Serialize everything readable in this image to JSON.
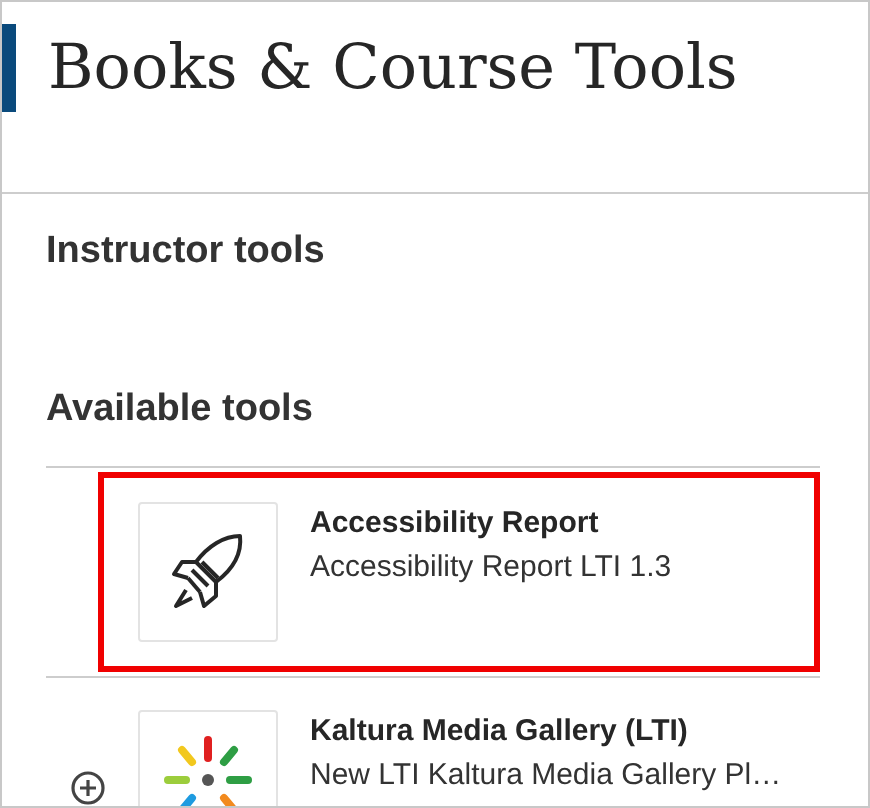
{
  "header": {
    "title": "Books & Course Tools"
  },
  "sections": [
    {
      "heading": "Instructor tools"
    },
    {
      "heading": "Available tools"
    }
  ],
  "tools": [
    {
      "kind": "rocket",
      "name": "Accessibility Report",
      "description": "Accessibility Report LTI 1.3",
      "highlighted": true,
      "add_button": false
    },
    {
      "kind": "burst",
      "name": "Kaltura Media Gallery (LTI)",
      "description": "New LTI Kaltura Media Gallery Pl…",
      "highlighted": false,
      "add_button": true
    }
  ]
}
